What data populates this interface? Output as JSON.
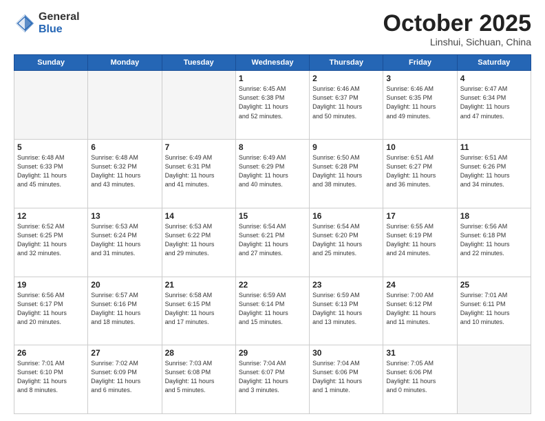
{
  "header": {
    "logo_general": "General",
    "logo_blue": "Blue",
    "month": "October 2025",
    "location": "Linshui, Sichuan, China"
  },
  "days_of_week": [
    "Sunday",
    "Monday",
    "Tuesday",
    "Wednesday",
    "Thursday",
    "Friday",
    "Saturday"
  ],
  "weeks": [
    [
      {
        "day": "",
        "info": ""
      },
      {
        "day": "",
        "info": ""
      },
      {
        "day": "",
        "info": ""
      },
      {
        "day": "1",
        "info": "Sunrise: 6:45 AM\nSunset: 6:38 PM\nDaylight: 11 hours\nand 52 minutes."
      },
      {
        "day": "2",
        "info": "Sunrise: 6:46 AM\nSunset: 6:37 PM\nDaylight: 11 hours\nand 50 minutes."
      },
      {
        "day": "3",
        "info": "Sunrise: 6:46 AM\nSunset: 6:35 PM\nDaylight: 11 hours\nand 49 minutes."
      },
      {
        "day": "4",
        "info": "Sunrise: 6:47 AM\nSunset: 6:34 PM\nDaylight: 11 hours\nand 47 minutes."
      }
    ],
    [
      {
        "day": "5",
        "info": "Sunrise: 6:48 AM\nSunset: 6:33 PM\nDaylight: 11 hours\nand 45 minutes."
      },
      {
        "day": "6",
        "info": "Sunrise: 6:48 AM\nSunset: 6:32 PM\nDaylight: 11 hours\nand 43 minutes."
      },
      {
        "day": "7",
        "info": "Sunrise: 6:49 AM\nSunset: 6:31 PM\nDaylight: 11 hours\nand 41 minutes."
      },
      {
        "day": "8",
        "info": "Sunrise: 6:49 AM\nSunset: 6:29 PM\nDaylight: 11 hours\nand 40 minutes."
      },
      {
        "day": "9",
        "info": "Sunrise: 6:50 AM\nSunset: 6:28 PM\nDaylight: 11 hours\nand 38 minutes."
      },
      {
        "day": "10",
        "info": "Sunrise: 6:51 AM\nSunset: 6:27 PM\nDaylight: 11 hours\nand 36 minutes."
      },
      {
        "day": "11",
        "info": "Sunrise: 6:51 AM\nSunset: 6:26 PM\nDaylight: 11 hours\nand 34 minutes."
      }
    ],
    [
      {
        "day": "12",
        "info": "Sunrise: 6:52 AM\nSunset: 6:25 PM\nDaylight: 11 hours\nand 32 minutes."
      },
      {
        "day": "13",
        "info": "Sunrise: 6:53 AM\nSunset: 6:24 PM\nDaylight: 11 hours\nand 31 minutes."
      },
      {
        "day": "14",
        "info": "Sunrise: 6:53 AM\nSunset: 6:22 PM\nDaylight: 11 hours\nand 29 minutes."
      },
      {
        "day": "15",
        "info": "Sunrise: 6:54 AM\nSunset: 6:21 PM\nDaylight: 11 hours\nand 27 minutes."
      },
      {
        "day": "16",
        "info": "Sunrise: 6:54 AM\nSunset: 6:20 PM\nDaylight: 11 hours\nand 25 minutes."
      },
      {
        "day": "17",
        "info": "Sunrise: 6:55 AM\nSunset: 6:19 PM\nDaylight: 11 hours\nand 24 minutes."
      },
      {
        "day": "18",
        "info": "Sunrise: 6:56 AM\nSunset: 6:18 PM\nDaylight: 11 hours\nand 22 minutes."
      }
    ],
    [
      {
        "day": "19",
        "info": "Sunrise: 6:56 AM\nSunset: 6:17 PM\nDaylight: 11 hours\nand 20 minutes."
      },
      {
        "day": "20",
        "info": "Sunrise: 6:57 AM\nSunset: 6:16 PM\nDaylight: 11 hours\nand 18 minutes."
      },
      {
        "day": "21",
        "info": "Sunrise: 6:58 AM\nSunset: 6:15 PM\nDaylight: 11 hours\nand 17 minutes."
      },
      {
        "day": "22",
        "info": "Sunrise: 6:59 AM\nSunset: 6:14 PM\nDaylight: 11 hours\nand 15 minutes."
      },
      {
        "day": "23",
        "info": "Sunrise: 6:59 AM\nSunset: 6:13 PM\nDaylight: 11 hours\nand 13 minutes."
      },
      {
        "day": "24",
        "info": "Sunrise: 7:00 AM\nSunset: 6:12 PM\nDaylight: 11 hours\nand 11 minutes."
      },
      {
        "day": "25",
        "info": "Sunrise: 7:01 AM\nSunset: 6:11 PM\nDaylight: 11 hours\nand 10 minutes."
      }
    ],
    [
      {
        "day": "26",
        "info": "Sunrise: 7:01 AM\nSunset: 6:10 PM\nDaylight: 11 hours\nand 8 minutes."
      },
      {
        "day": "27",
        "info": "Sunrise: 7:02 AM\nSunset: 6:09 PM\nDaylight: 11 hours\nand 6 minutes."
      },
      {
        "day": "28",
        "info": "Sunrise: 7:03 AM\nSunset: 6:08 PM\nDaylight: 11 hours\nand 5 minutes."
      },
      {
        "day": "29",
        "info": "Sunrise: 7:04 AM\nSunset: 6:07 PM\nDaylight: 11 hours\nand 3 minutes."
      },
      {
        "day": "30",
        "info": "Sunrise: 7:04 AM\nSunset: 6:06 PM\nDaylight: 11 hours\nand 1 minute."
      },
      {
        "day": "31",
        "info": "Sunrise: 7:05 AM\nSunset: 6:06 PM\nDaylight: 11 hours\nand 0 minutes."
      },
      {
        "day": "",
        "info": ""
      }
    ]
  ]
}
